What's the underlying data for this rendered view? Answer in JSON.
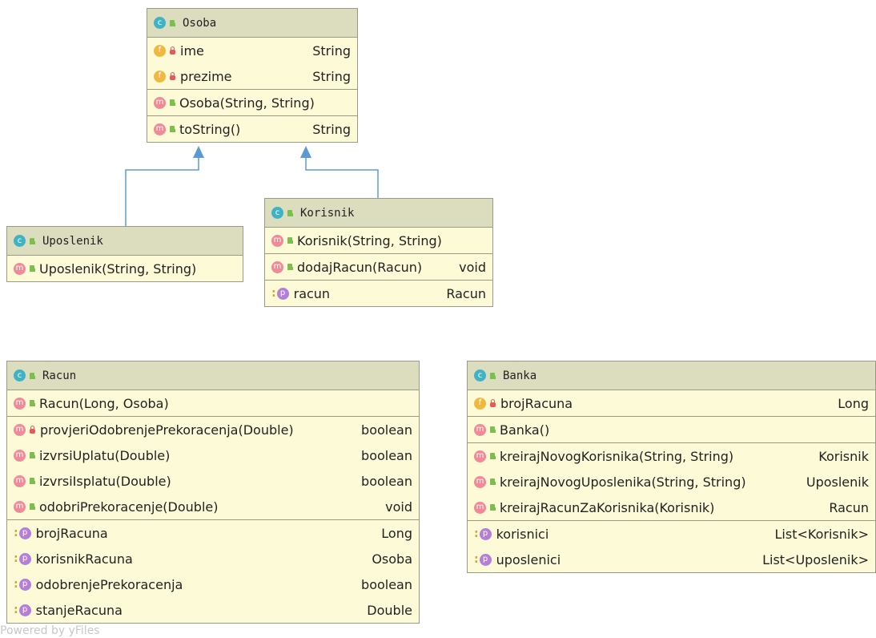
{
  "classes": {
    "osoba": {
      "name": "Osoba",
      "fields": [
        {
          "name": "ime",
          "type": "String"
        },
        {
          "name": "prezime",
          "type": "String"
        }
      ],
      "constructors": [
        {
          "name": "Osoba(String, String)"
        }
      ],
      "methods": [
        {
          "name": "toString()",
          "type": "String"
        }
      ]
    },
    "uposlenik": {
      "name": "Uposlenik",
      "constructors": [
        {
          "name": "Uposlenik(String, String)"
        }
      ]
    },
    "korisnik": {
      "name": "Korisnik",
      "constructors": [
        {
          "name": "Korisnik(String, String)"
        }
      ],
      "methods": [
        {
          "name": "dodajRacun(Racun)",
          "type": "void"
        }
      ],
      "properties": [
        {
          "name": "racun",
          "type": "Racun"
        }
      ]
    },
    "racun": {
      "name": "Racun",
      "methods": [
        {
          "name": "Racun(Long, Osoba)",
          "type": ""
        },
        {
          "name": "provjeriOdobrenjePrekoracenja(Double)",
          "type": "boolean"
        },
        {
          "name": "izvrsiUplatu(Double)",
          "type": "boolean"
        },
        {
          "name": "izvrsiIsplatu(Double)",
          "type": "boolean"
        },
        {
          "name": "odobriPrekoracenje(Double)",
          "type": "void"
        }
      ],
      "properties": [
        {
          "name": "brojRacuna",
          "type": "Long"
        },
        {
          "name": "korisnikRacuna",
          "type": "Osoba"
        },
        {
          "name": "odobrenjePrekoracenja",
          "type": "boolean"
        },
        {
          "name": "stanjeRacuna",
          "type": "Double"
        }
      ]
    },
    "banka": {
      "name": "Banka",
      "fields": [
        {
          "name": "brojRacuna",
          "type": "Long"
        }
      ],
      "constructors": [
        {
          "name": "Banka()"
        }
      ],
      "methods": [
        {
          "name": "kreirajNovogKorisnika(String, String)",
          "type": "Korisnik"
        },
        {
          "name": "kreirajNovogUposlenika(String, String)",
          "type": "Uposlenik"
        },
        {
          "name": "kreirajRacunZaKorisnika(Korisnik)",
          "type": "Racun"
        }
      ],
      "properties": [
        {
          "name": "korisnici",
          "type": "List<Korisnik>"
        },
        {
          "name": "uposlenici",
          "type": "List<Uposlenik>"
        }
      ]
    }
  },
  "watermark": "Powered by yFiles",
  "colors": {
    "edge": "#5b9bd5",
    "header": "#dcdcbe",
    "body": "#fdfbd7"
  }
}
